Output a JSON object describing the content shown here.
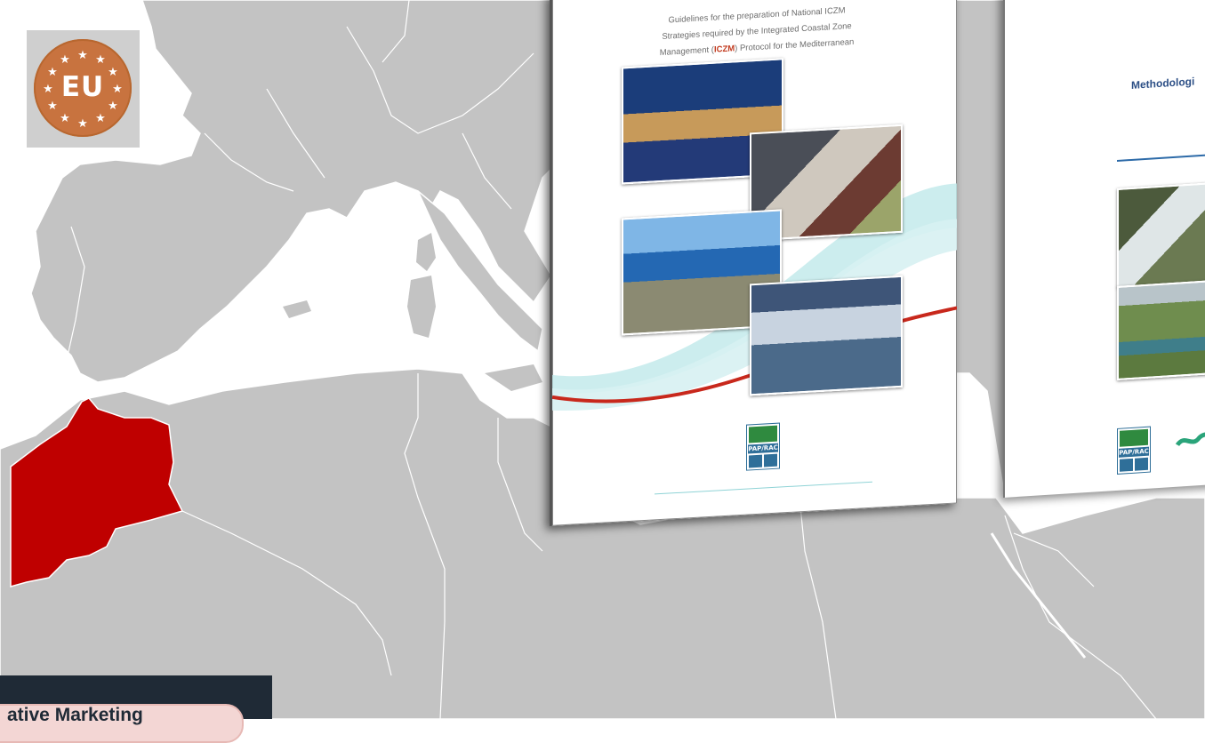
{
  "badge": {
    "text": "EU",
    "color": "#c8733f"
  },
  "map": {
    "land_color": "#c3c3c3",
    "border_color": "#ffffff",
    "highlight_color": "#bf0000",
    "highlighted_country": "Morocco"
  },
  "document_1": {
    "subtitle_lines": [
      "Guidelines for the preparation of National ICZM",
      "Strategies required by the Integrated Coastal Zone"
    ],
    "subtitle_line3_prefix": "Management (",
    "subtitle_highlight": "ICZM",
    "subtitle_line3_suffix": ") Protocol for the Mediterranean",
    "logo_text": "PAP/RAC"
  },
  "document_2": {
    "title": "Methodologi",
    "logo_text": "PAP/RAC"
  },
  "caption": {
    "text": "ative Marketing"
  }
}
